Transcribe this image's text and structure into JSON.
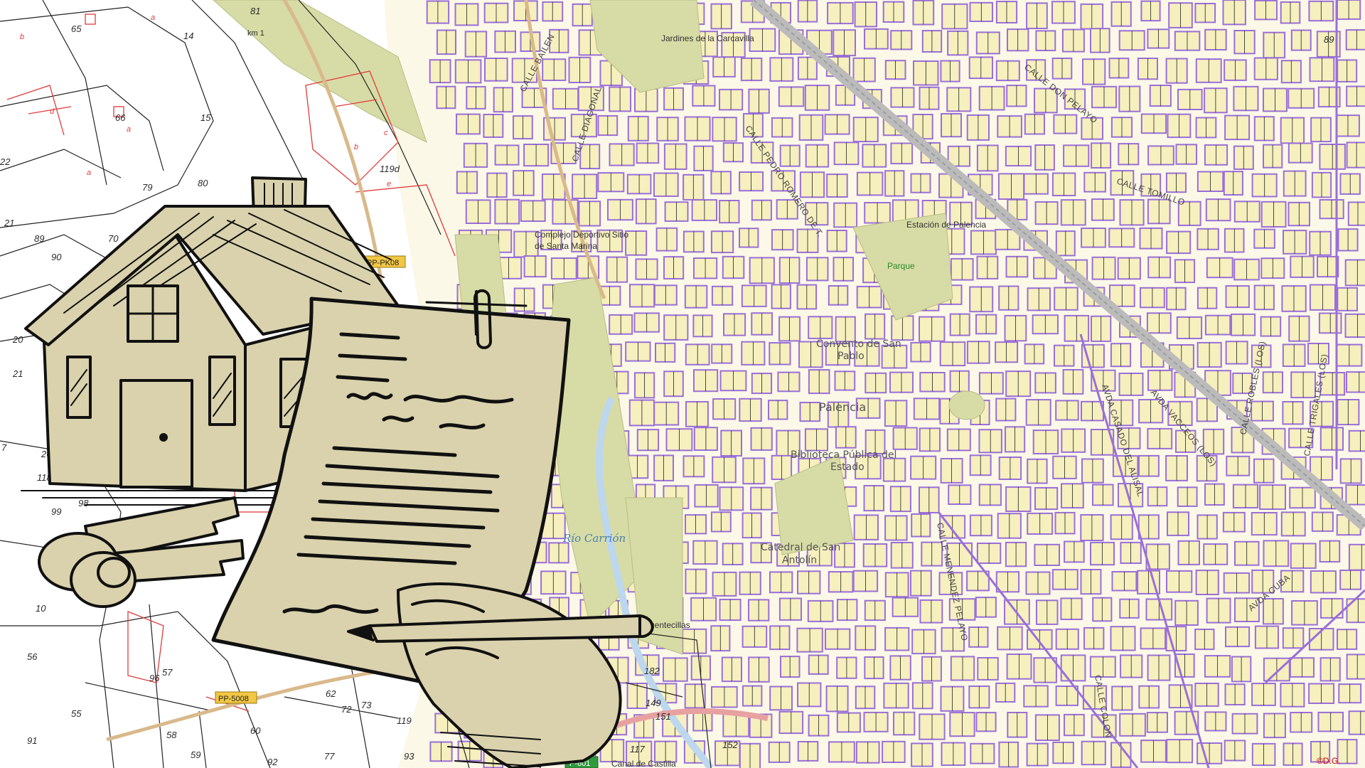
{
  "colors": {
    "block_fill": "#f6efbe",
    "block_stroke": "#9a6fd8",
    "green": "#d7dca6",
    "parcel_line": "#222222",
    "cadastre_red": "#e03b3b",
    "paper_tan": "#d9d2ac",
    "ink": "#111111",
    "river_blue": "#4a7fb0"
  },
  "map": {
    "city": "Palencia",
    "credit": "©D.G.",
    "river": "Río Carrión",
    "places": {
      "jardines": "Jardines de la Carcavilla",
      "complejo_line1": "Complejo Deportivo Sitio",
      "complejo_line2": "de Santa Marina",
      "estacion": "Estación de Palencia",
      "parque": "Parque",
      "convento_line1": "Convento de San",
      "convento_line2": "Pablo",
      "biblioteca_line1": "Biblioteca Pública del",
      "biblioteca_line2": "Estado",
      "catedral_line1": "Catedral de San",
      "catedral_line2": "Antolín",
      "puentecillas": "Puentecillas",
      "canal": "Canal de Castilla"
    },
    "streets": {
      "bailen": "CALLE BAILEN",
      "diagonal": "CALLE DIAGONAL",
      "pedro_romero": "CALLE PEDRO ROMERO DE T.",
      "don_pelayo": "CALLE DON PELAYO",
      "tomillo": "CALLE TOMILLO",
      "avda_vacceos": "AVDA VACCEOS (LOS)",
      "robles": "CALLE ROBLES (LOS)",
      "trigales": "CALLE TRIGALES (LOS)",
      "casado_alisal": "AVDA CASADO DEL ALISAL",
      "cuba": "AVDA CUBA",
      "menendez": "CALLE MENENDEZ PELAYO",
      "colon": "CALLE COLON"
    },
    "road_shields": [
      "PP-PK08",
      "PP-5008",
      "P-601"
    ],
    "km_marker": "km 1",
    "parcels": [
      "65",
      "14",
      "81",
      "66",
      "15",
      "22",
      "80",
      "79",
      "119d",
      "21",
      "89",
      "90",
      "70",
      "20",
      "21",
      "7",
      "26",
      "118",
      "99",
      "98",
      "10",
      "96",
      "56",
      "57",
      "55",
      "91",
      "58",
      "59",
      "60",
      "62",
      "72",
      "73",
      "119",
      "77",
      "93",
      "92",
      "182",
      "149",
      "151",
      "117",
      "152",
      "89"
    ],
    "subparcels": [
      "b",
      "a",
      "d",
      "c",
      "a",
      "b",
      "a",
      "e"
    ]
  },
  "illustration": {
    "house": "house-icon",
    "document": "contract-icon",
    "keys": "keys-icon",
    "hand_pen": "signing-hand-icon"
  }
}
